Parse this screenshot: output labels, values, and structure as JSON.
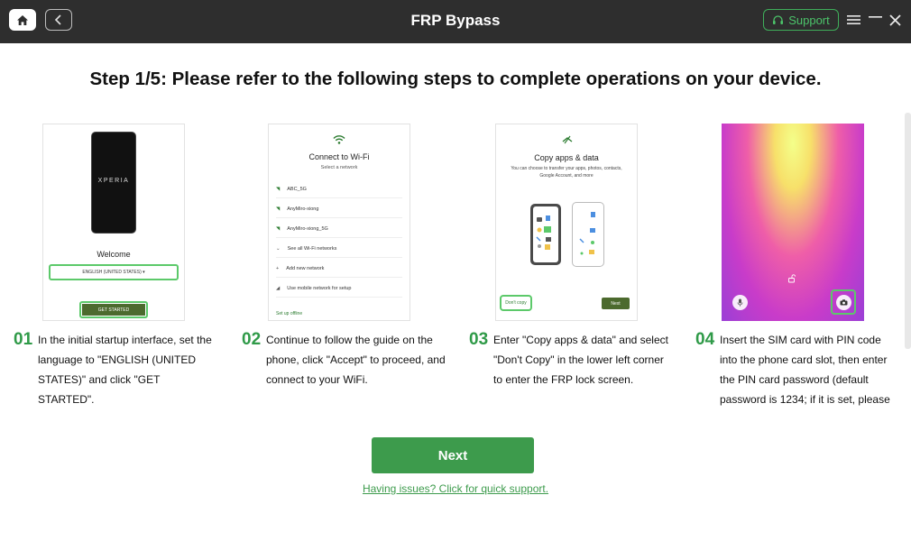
{
  "titlebar": {
    "app_title": "FRP Bypass",
    "support_label": "Support",
    "icons": [
      "home-icon",
      "back-arrow-icon",
      "headset-icon",
      "menu-icon",
      "minimize-icon",
      "close-icon"
    ]
  },
  "step": {
    "title": "Step 1/5: Please refer to the following steps to complete operations on your device."
  },
  "cards": [
    {
      "number": "01",
      "text": "In the initial startup interface, set the language to \"ENGLISH (UNITED STATES)\" and click \"GET STARTED\".",
      "screen": {
        "brand": "XPERIA",
        "welcome": "Welcome",
        "language": "ENGLISH (UNITED STATES) ▾",
        "start_button": "GET STARTED"
      }
    },
    {
      "number": "02",
      "text": "Continue to follow the guide on the phone, click \"Accept\" to proceed, and connect to your WiFi.",
      "screen": {
        "title": "Connect to Wi-Fi",
        "subtitle": "Select a network",
        "rows": [
          "ABC_5G",
          "AnyMiro-xiong",
          "AnyMiro-xiong_5G",
          "See all Wi-Fi networks",
          "Add new network",
          "Use mobile network for setup"
        ],
        "footer": "Set up offline"
      }
    },
    {
      "number": "03",
      "text": "Enter \"Copy apps & data\" and select \"Don't Copy\" in the lower left corner to enter the FRP lock screen.",
      "screen": {
        "title": "Copy apps & data",
        "subtitle": "You can choose to transfer your apps, photos, contacts, Google Account, and more",
        "dont_copy": "Don't copy",
        "next": "Next"
      }
    },
    {
      "number": "04",
      "text": "Insert the SIM card with PIN code into the phone card slot, then enter the PIN card password (default password is 1234; if it is set, please"
    }
  ],
  "actions": {
    "next_label": "Next",
    "help_link": "Having issues? Click for quick support."
  },
  "colors": {
    "titlebar": "#2e2e2e",
    "accent_green": "#3d9b4c",
    "highlight_green": "#5cc96a"
  }
}
